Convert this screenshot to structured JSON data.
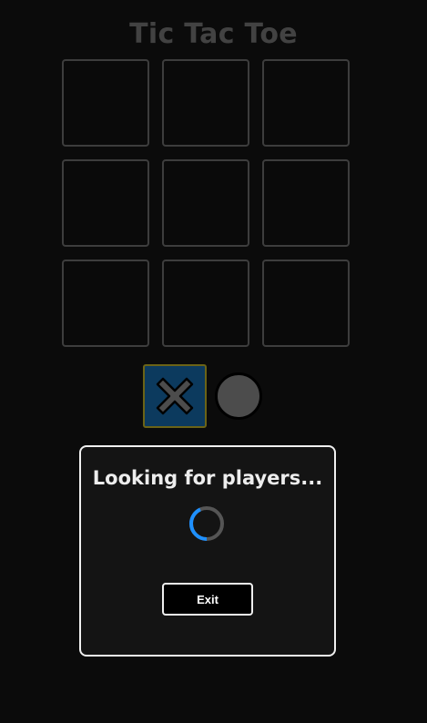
{
  "game": {
    "title": "Tic Tac Toe",
    "board": [
      "",
      "",
      "",
      "",
      "",
      "",
      "",
      "",
      ""
    ],
    "selected_piece": "X",
    "pieces": [
      "X",
      "O"
    ]
  },
  "modal": {
    "title": "Looking for players...",
    "exit_label": "Exit"
  },
  "colors": {
    "background": "#0b0b0b",
    "title": "#424242",
    "cell_border": "#3d3d3d",
    "x_tile_bg": "#0c3a5e",
    "x_tile_border": "#6b6316",
    "x_glyph": "#4c4c4c",
    "o_piece": "#4c4c4c",
    "spinner_accent": "#1e90ff",
    "modal_border": "#f0f0f0"
  },
  "icons": {
    "x_piece": "x-mark-icon",
    "o_piece": "circle-icon",
    "loading": "spinner-icon"
  }
}
